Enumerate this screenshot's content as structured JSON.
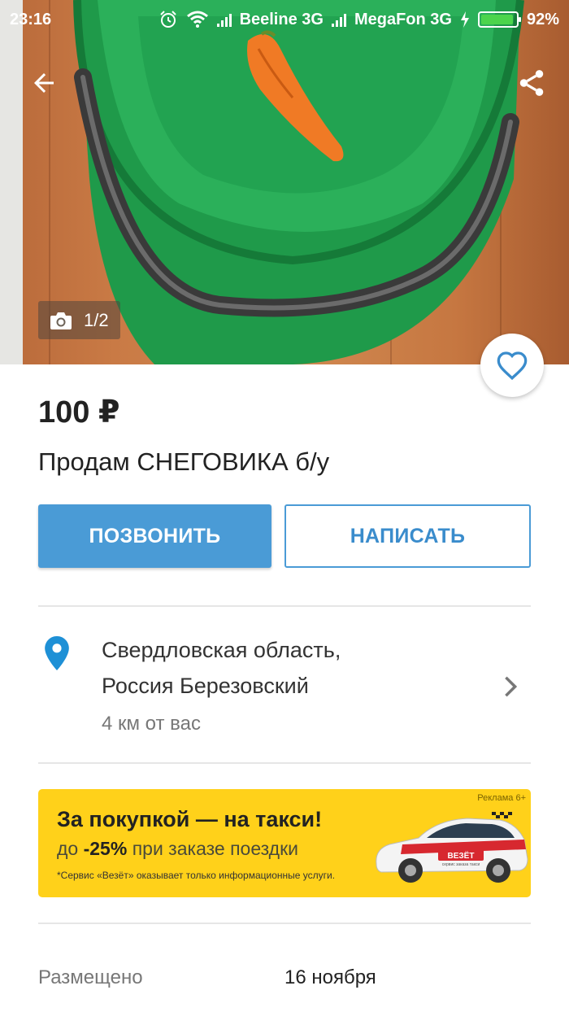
{
  "status_bar": {
    "time": "23:16",
    "carrier1": "Beeline 3G",
    "carrier2": "MegaFon 3G",
    "battery": "92%",
    "battery_level": 0.92,
    "icons": [
      "alarm-icon",
      "wifi-icon",
      "signal-icon",
      "signal-icon",
      "charging-icon",
      "battery-icon"
    ]
  },
  "header": {
    "back_icon": "arrow-left-icon",
    "share_icon": "share-icon"
  },
  "gallery": {
    "counter": "1/2",
    "camera_icon": "camera-icon"
  },
  "favorite_icon": "heart-outline-icon",
  "listing": {
    "price": "100 ₽",
    "title": "Продам СНЕГОВИКА б/у"
  },
  "actions": {
    "call_label": "ПОЗВОНИТЬ",
    "write_label": "НАПИСАТЬ"
  },
  "location": {
    "line1": "Свердловская область,",
    "line2": "Россия Березовский",
    "distance": "4 км от вас",
    "pin_icon": "location-pin-icon",
    "chevron_icon": "chevron-right-icon"
  },
  "ad": {
    "label": "Реклама 6+",
    "title": "За покупкой — на такси!",
    "subtitle_prefix": "до",
    "subtitle_discount": "-25%",
    "subtitle_suffix": "при заказе поездки",
    "note": "*Сервис «Везёт» оказывает только информационные услуги.",
    "car_brand": "ВЕЗЁТ",
    "car_tagline": "сервис заказа такси"
  },
  "details": {
    "posted_label": "Размещено",
    "posted_value": "16 ноября"
  },
  "colors": {
    "accent": "#4a9bd6",
    "ad_background": "#ffd11a",
    "bucket": "#1f9a4a"
  }
}
